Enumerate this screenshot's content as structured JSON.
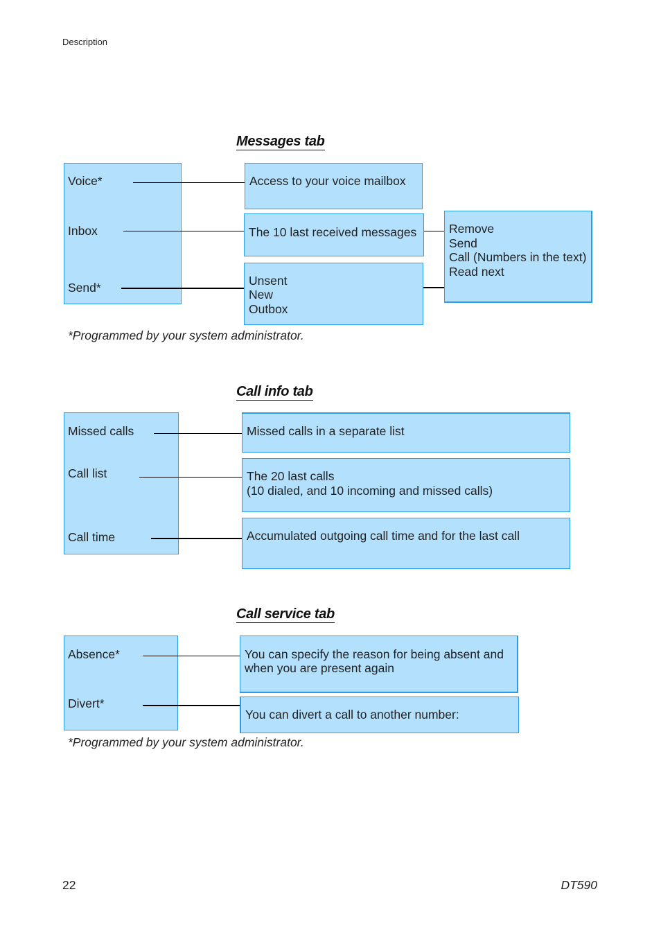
{
  "header": {
    "section": "Description"
  },
  "messages_tab": {
    "title": "Messages tab",
    "menu_items": [
      "Voice*",
      "Inbox",
      "Send*"
    ],
    "voice_desc": "Access to your voice mailbox",
    "inbox_desc": "The 10 last received messages",
    "send_options": [
      "Unsent",
      "New",
      "Outbox"
    ],
    "message_actions": [
      "Remove",
      "Send",
      "Call (Numbers in the text)",
      "Read next"
    ],
    "footnote": "*Programmed by your system administrator."
  },
  "call_info_tab": {
    "title": "Call info tab",
    "menu_items": [
      "Missed calls",
      "Call list",
      "Call time"
    ],
    "missed_desc": "Missed calls in a separate list",
    "call_list_desc": [
      "The 20 last calls",
      "(10 dialed, and 10 incoming and missed calls)"
    ],
    "call_time_desc": "Accumulated outgoing call time and for the last call"
  },
  "call_service_tab": {
    "title": "Call service tab",
    "menu_items": [
      "Absence*",
      "Divert*"
    ],
    "absence_desc": [
      "You can specify the reason for being absent and",
      "when you are present again"
    ],
    "divert_desc": "You can divert a call to another number:",
    "footnote": "*Programmed by your system administrator."
  },
  "footer": {
    "page_number": "22",
    "product": "DT590"
  }
}
